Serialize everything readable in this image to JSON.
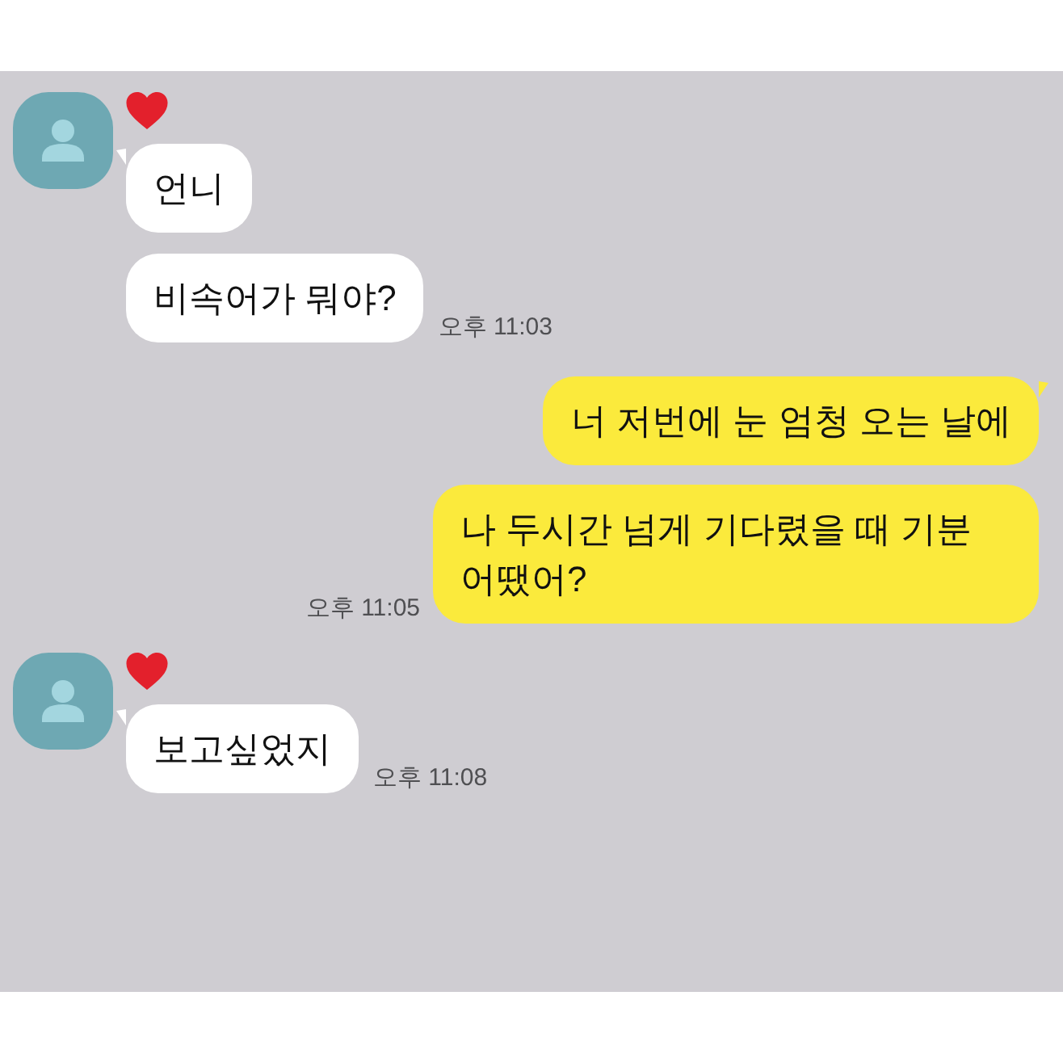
{
  "chat": {
    "messages": [
      {
        "kind": "received",
        "texts": [
          "언니",
          "비속어가 뭐야?"
        ],
        "time": "오후 11:03"
      },
      {
        "kind": "sent",
        "texts": [
          "너 저번에 눈 엄청 오는 날에",
          "나 두시간 넘게 기다렸을 때 기분 어땠어?"
        ],
        "time": "오후 11:05"
      },
      {
        "kind": "received",
        "texts": [
          "보고싶었지"
        ],
        "time": "오후 11:08"
      }
    ]
  }
}
